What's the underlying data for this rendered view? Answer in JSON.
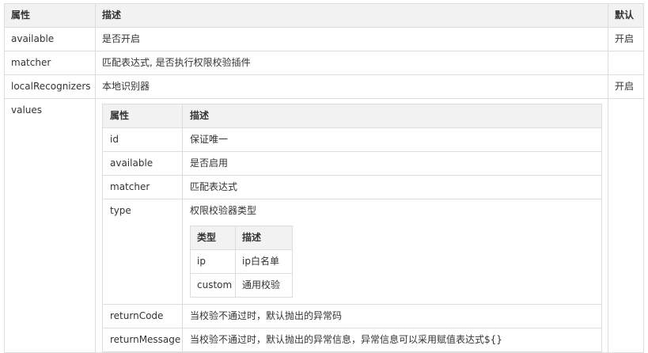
{
  "outer": {
    "headers": {
      "attr": "属性",
      "desc": "描述",
      "default": "默认"
    },
    "rows": [
      {
        "name": "available",
        "desc": "是否开启",
        "default": "开启"
      },
      {
        "name": "matcher",
        "desc": "匹配表达式, 是否执行权限校验插件",
        "default": ""
      },
      {
        "name": "localRecognizers",
        "desc": "本地识别器",
        "default": "开启"
      },
      {
        "name": "values",
        "desc": "",
        "default": ""
      }
    ]
  },
  "values_table": {
    "headers": {
      "attr": "属性",
      "desc": "描述"
    },
    "rows": [
      {
        "name": "id",
        "desc": "保证唯一"
      },
      {
        "name": "available",
        "desc": "是否启用"
      },
      {
        "name": "matcher",
        "desc": "匹配表达式"
      },
      {
        "name": "type",
        "desc": "权限校验器类型"
      },
      {
        "name": "returnCode",
        "desc": "当校验不通过时，默认抛出的异常码"
      },
      {
        "name": "returnMessage",
        "desc": "当校验不通过时，默认抛出的异常信息，异常信息可以采用赋值表达式${}"
      }
    ]
  },
  "type_table": {
    "headers": {
      "type": "类型",
      "desc": "描述"
    },
    "rows": [
      {
        "type": "ip",
        "desc": "ip白名单"
      },
      {
        "type": "custom",
        "desc": "通用校验"
      }
    ]
  }
}
